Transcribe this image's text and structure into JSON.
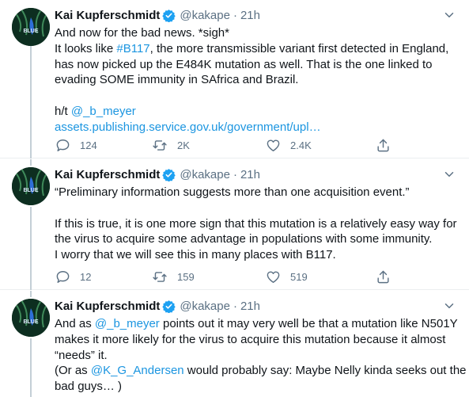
{
  "tweets": [
    {
      "name": "Kai Kupferschmidt",
      "handle": "@kakape",
      "separator": "·",
      "time": "21h",
      "avatar_text": "BLUE",
      "lines": [
        {
          "pre": "And now for the bad news. *sigh*",
          "link": "",
          "post": ""
        },
        {
          "pre": "It looks like ",
          "link": "#B117",
          "post": ", the more transmissible variant first detected in England,"
        },
        {
          "pre": "has now picked up the E484K mutation as well. That is the one linked to",
          "link": "",
          "post": ""
        },
        {
          "pre": "evading SOME immunity in SAfrica and Brazil.",
          "link": "",
          "post": ""
        },
        {
          "pre": "",
          "link": "",
          "post": ""
        },
        {
          "pre": "h/t ",
          "link": "@_b_meyer",
          "post": ""
        },
        {
          "pre": "",
          "link": "assets.publishing.service.gov.uk/government/upl…",
          "post": ""
        }
      ],
      "replies": "124",
      "retweets": "2K",
      "likes": "2.4K"
    },
    {
      "name": "Kai Kupferschmidt",
      "handle": "@kakape",
      "separator": "·",
      "time": "21h",
      "avatar_text": "BLUE",
      "lines": [
        {
          "pre": "“Preliminary information suggests more than one acquisition event.”",
          "link": "",
          "post": ""
        },
        {
          "pre": "",
          "link": "",
          "post": ""
        },
        {
          "pre": "If this is true, it is one more sign that this mutation is a relatively easy way for",
          "link": "",
          "post": ""
        },
        {
          "pre": "the virus to acquire some advantage in populations with some immunity.",
          "link": "",
          "post": ""
        },
        {
          "pre": "I worry that we will see this in many places with B117.",
          "link": "",
          "post": ""
        }
      ],
      "replies": "12",
      "retweets": "159",
      "likes": "519"
    },
    {
      "name": "Kai Kupferschmidt",
      "handle": "@kakape",
      "separator": "·",
      "time": "21h",
      "avatar_text": "BLUE",
      "lines": [
        {
          "pre": "And as ",
          "link": "@_b_meyer",
          "post": " points out it may very well be that a mutation like N501Y"
        },
        {
          "pre": "makes it more likely for the virus to acquire this mutation because it almost",
          "link": "",
          "post": ""
        },
        {
          "pre": "“needs” it.",
          "link": "",
          "post": ""
        },
        {
          "pre": "(Or as ",
          "link": "@K_G_Andersen",
          "post": " would probably say: Maybe Nelly kinda seeks out the"
        },
        {
          "pre": "bad guys… )",
          "link": "",
          "post": ""
        }
      ]
    }
  ],
  "icons": {
    "verified": "verified-badge-icon",
    "more": "more-options-icon",
    "reply": "reply-icon",
    "retweet": "retweet-icon",
    "like": "heart-icon",
    "share": "share-icon"
  },
  "colors": {
    "link": "#1b95e0",
    "verified": "#1da1f2",
    "secondary_text": "#5b7083",
    "thread_line": "#c4cfd6"
  }
}
